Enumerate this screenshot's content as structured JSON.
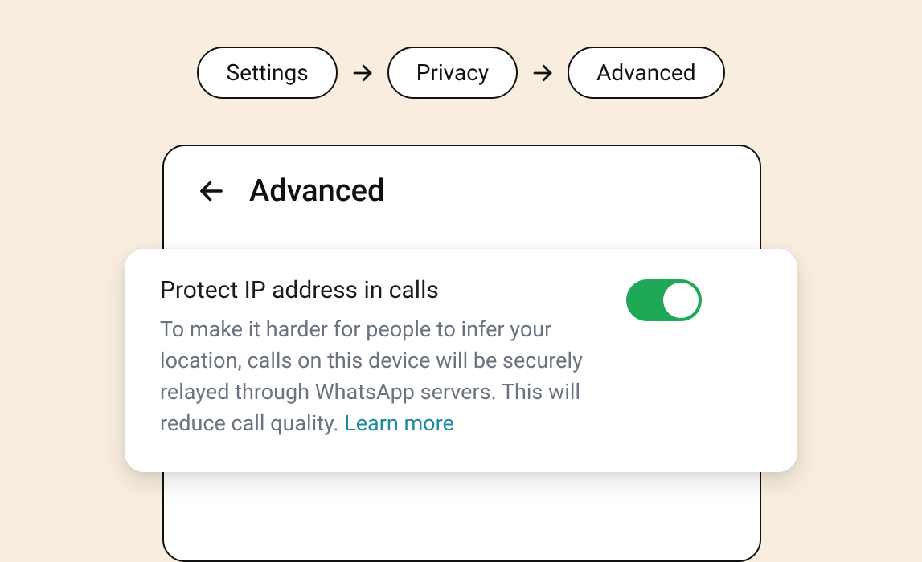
{
  "breadcrumb": {
    "items": [
      "Settings",
      "Privacy",
      "Advanced"
    ]
  },
  "screen": {
    "title": "Advanced"
  },
  "setting": {
    "title": "Protect IP address in calls",
    "description": "To make it harder for people to infer your location, calls on this device will be securely relayed through WhatsApp servers. This will reduce call quality. ",
    "learn_more": "Learn more",
    "enabled": true
  },
  "colors": {
    "bg": "#f8edde",
    "toggle_on": "#1fa855",
    "link": "#1b8c9e"
  }
}
